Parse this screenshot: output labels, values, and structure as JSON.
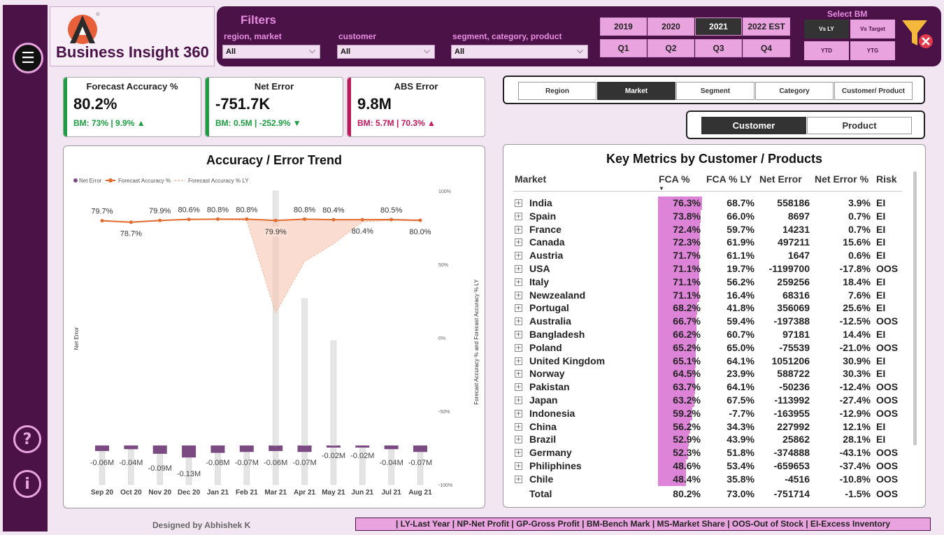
{
  "app": {
    "title": "Business Insight 360",
    "designer": "Designed by Abhishek K",
    "glossary": "| LY-Last Year | NP-Net Profit | GP-Gross Profit | BM-Bench Mark | MS-Market Share | OOS-Out of Stock | EI-Excess Inventory"
  },
  "sidebar": {
    "menu_icon": "menu-icon",
    "help_label": "?",
    "info_label": "i"
  },
  "filters": {
    "title": "Filters",
    "region_label": "region, market",
    "region_value": "All",
    "customer_label": "customer",
    "customer_value": "All",
    "segment_label": "segment, category, product",
    "segment_value": "All",
    "years": [
      "2019",
      "2020",
      "2021",
      "2022 EST"
    ],
    "active_year": "2021",
    "quarters": [
      "Q1",
      "Q2",
      "Q3",
      "Q4"
    ],
    "bm_title": "Select BM",
    "bm_options": [
      "Vs LY",
      "Vs Target",
      "YTD",
      "YTG"
    ],
    "active_bm": "Vs LY",
    "clear_icon": "clear-filter-icon"
  },
  "kpis": [
    {
      "title": "Forecast Accuracy %",
      "value": "80.2%",
      "bm": "BM: 73% | 9.9% ▲",
      "color": "#1a9e3f"
    },
    {
      "title": "Net Error",
      "value": "-751.7K",
      "bm": "BM: 0.5M | -252.9% ▼",
      "color": "#1a9e3f"
    },
    {
      "title": "ABS Error",
      "value": "9.8M",
      "bm": "BM: 5.7M | 70.3% ▲",
      "color": "#c2185b"
    }
  ],
  "dimensions": {
    "options": [
      "Region",
      "Market",
      "Segment",
      "Category",
      "Customer/ Product"
    ],
    "active": "Market"
  },
  "view_toggle": {
    "options": [
      "Customer",
      "Product"
    ],
    "active": "Customer"
  },
  "chart_data": {
    "type": "line",
    "title": "Accuracy / Error Trend",
    "categories": [
      "Sep 20",
      "Oct 20",
      "Nov 20",
      "Dec 20",
      "Jan 21",
      "Feb 21",
      "Mar 21",
      "Apr 21",
      "May 21",
      "Jun 21",
      "Jul 21",
      "Aug 21"
    ],
    "legend": [
      "Net Error",
      "Forecast Accuracy %",
      "Forecast Accuracy % LY"
    ],
    "series": [
      {
        "name": "Forecast Accuracy %",
        "values": [
          79.7,
          78.7,
          79.9,
          80.6,
          80.8,
          80.8,
          79.9,
          80.8,
          80.4,
          80.4,
          80.5,
          80.0
        ],
        "labels": [
          "79.7%",
          "78.7%",
          "79.9%",
          "80.6%",
          "80.8%",
          "80.8%",
          "79.9%",
          "80.8%",
          "80.4%",
          "80.4%",
          "80.5%",
          "80.0%"
        ],
        "color": "#e26a2c"
      },
      {
        "name": "Forecast Accuracy % LY",
        "values": [
          79.5,
          79,
          79.5,
          81,
          80.5,
          80,
          17,
          52,
          64,
          79,
          80,
          79.5
        ],
        "color": "#f5b59a"
      },
      {
        "name": "Net Error",
        "values": [
          -0.06,
          -0.04,
          -0.09,
          -0.13,
          -0.08,
          -0.07,
          -0.06,
          -0.07,
          -0.02,
          -0.02,
          -0.04,
          -0.07
        ],
        "labels": [
          "-0.06M",
          "-0.04M",
          "-0.09M",
          "-0.13M",
          "-0.08M",
          "-0.07M",
          "-0.06M",
          "-0.07M",
          "-0.02M",
          "-0.02M",
          "-0.04M",
          "-0.07M"
        ],
        "color": "#7b4a83"
      }
    ],
    "ylabel_left": "Net Error",
    "ylabel_right": "Forecast Accuracy % and Forecast Accuracy % LY",
    "right_ticks": [
      "100%",
      "50%",
      "0%",
      "-50%",
      "-100%"
    ],
    "right_tick_values": [
      100,
      50,
      0,
      -50,
      -100
    ],
    "ylim_right": [
      -100,
      100
    ]
  },
  "table": {
    "title": "Key Metrics by Customer / Products",
    "headers": {
      "name": "Market",
      "fca": "FCA %",
      "ly": "FCA % LY",
      "ne": "Net Error",
      "nep": "Net Error %",
      "risk": "Risk"
    },
    "sort_icon": "sort-desc-icon",
    "rows": [
      {
        "name": "India",
        "fca": "76.3%",
        "fca_value": 76.3,
        "ly": "68.7%",
        "ne": "558186",
        "nep": "3.9%",
        "risk": "EI"
      },
      {
        "name": "Spain",
        "fca": "73.8%",
        "fca_value": 73.8,
        "ly": "66.0%",
        "ne": "8697",
        "nep": "0.7%",
        "risk": "EI"
      },
      {
        "name": "France",
        "fca": "72.4%",
        "fca_value": 72.4,
        "ly": "59.7%",
        "ne": "14231",
        "nep": "0.7%",
        "risk": "EI"
      },
      {
        "name": "Canada",
        "fca": "72.3%",
        "fca_value": 72.3,
        "ly": "61.9%",
        "ne": "497211",
        "nep": "15.6%",
        "risk": "EI"
      },
      {
        "name": "Austria",
        "fca": "71.7%",
        "fca_value": 71.7,
        "ly": "61.1%",
        "ne": "1647",
        "nep": "0.6%",
        "risk": "EI"
      },
      {
        "name": "USA",
        "fca": "71.1%",
        "fca_value": 71.1,
        "ly": "19.7%",
        "ne": "-1199700",
        "nep": "-17.8%",
        "risk": "OOS"
      },
      {
        "name": "Italy",
        "fca": "71.1%",
        "fca_value": 71.1,
        "ly": "56.2%",
        "ne": "259256",
        "nep": "18.4%",
        "risk": "EI"
      },
      {
        "name": "Newzealand",
        "fca": "71.1%",
        "fca_value": 71.1,
        "ly": "16.4%",
        "ne": "68316",
        "nep": "7.6%",
        "risk": "EI"
      },
      {
        "name": "Portugal",
        "fca": "68.2%",
        "fca_value": 68.2,
        "ly": "41.8%",
        "ne": "356069",
        "nep": "25.6%",
        "risk": "EI"
      },
      {
        "name": "Australia",
        "fca": "66.7%",
        "fca_value": 66.7,
        "ly": "59.4%",
        "ne": "-197388",
        "nep": "-12.5%",
        "risk": "OOS"
      },
      {
        "name": "Bangladesh",
        "fca": "66.2%",
        "fca_value": 66.2,
        "ly": "60.7%",
        "ne": "97181",
        "nep": "14.4%",
        "risk": "EI"
      },
      {
        "name": "Poland",
        "fca": "65.2%",
        "fca_value": 65.2,
        "ly": "65.0%",
        "ne": "-75539",
        "nep": "-21.0%",
        "risk": "OOS"
      },
      {
        "name": "United Kingdom",
        "fca": "65.1%",
        "fca_value": 65.1,
        "ly": "64.1%",
        "ne": "1051206",
        "nep": "30.9%",
        "risk": "EI"
      },
      {
        "name": "Norway",
        "fca": "64.5%",
        "fca_value": 64.5,
        "ly": "23.9%",
        "ne": "588722",
        "nep": "30.3%",
        "risk": "EI"
      },
      {
        "name": "Pakistan",
        "fca": "63.7%",
        "fca_value": 63.7,
        "ly": "64.1%",
        "ne": "-50236",
        "nep": "-12.4%",
        "risk": "OOS"
      },
      {
        "name": "Japan",
        "fca": "63.2%",
        "fca_value": 63.2,
        "ly": "67.5%",
        "ne": "-113992",
        "nep": "-27.4%",
        "risk": "OOS"
      },
      {
        "name": "Indonesia",
        "fca": "59.2%",
        "fca_value": 59.2,
        "ly": "-7.7%",
        "ne": "-163955",
        "nep": "-12.9%",
        "risk": "OOS"
      },
      {
        "name": "China",
        "fca": "56.2%",
        "fca_value": 56.2,
        "ly": "34.3%",
        "ne": "227992",
        "nep": "12.1%",
        "risk": "EI"
      },
      {
        "name": "Brazil",
        "fca": "52.9%",
        "fca_value": 52.9,
        "ly": "43.9%",
        "ne": "25862",
        "nep": "28.1%",
        "risk": "EI"
      },
      {
        "name": "Germany",
        "fca": "52.3%",
        "fca_value": 52.3,
        "ly": "51.8%",
        "ne": "-374888",
        "nep": "-43.1%",
        "risk": "OOS"
      },
      {
        "name": "Philiphines",
        "fca": "48.6%",
        "fca_value": 48.6,
        "ly": "53.4%",
        "ne": "-659653",
        "nep": "-37.4%",
        "risk": "OOS"
      },
      {
        "name": "Chile",
        "fca": "48.4%",
        "fca_value": 48.4,
        "ly": "35.8%",
        "ne": "-4516",
        "nep": "-10.8%",
        "risk": "OOS"
      }
    ],
    "total": {
      "name": "Total",
      "fca": "80.2%",
      "ly": "73.0%",
      "ne": "-751714",
      "nep": "-1.5%",
      "risk": "OOS"
    }
  }
}
